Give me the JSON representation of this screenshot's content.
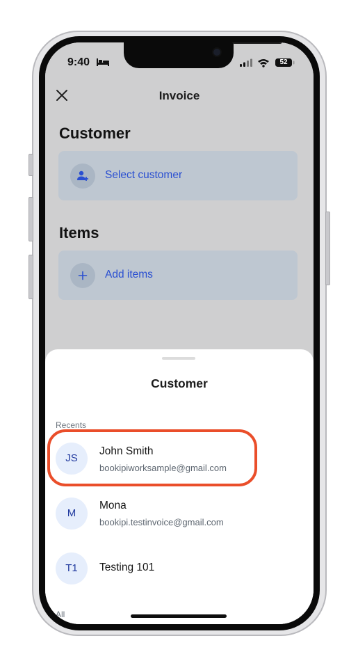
{
  "status_bar": {
    "time": "9:40",
    "battery": "52"
  },
  "nav": {
    "title": "Invoice"
  },
  "customer_section": {
    "title": "Customer",
    "action_label": "Select customer"
  },
  "items_section": {
    "title": "Items",
    "action_label": "Add items"
  },
  "sheet": {
    "title": "Customer",
    "recents_label": "Recents",
    "all_label": "All",
    "recents": [
      {
        "initials": "JS",
        "name": "John Smith",
        "email": "bookipiworksample@gmail.com"
      },
      {
        "initials": "M",
        "name": "Mona",
        "email": "bookipi.testinvoice@gmail.com"
      },
      {
        "initials": "T1",
        "name": "Testing 101",
        "email": ""
      }
    ]
  },
  "colors": {
    "accent": "#2a4fd1",
    "highlight": "#ea4e2a",
    "avatar_bg": "#e6eefc",
    "dim_overlay": "#cfcfd0"
  }
}
